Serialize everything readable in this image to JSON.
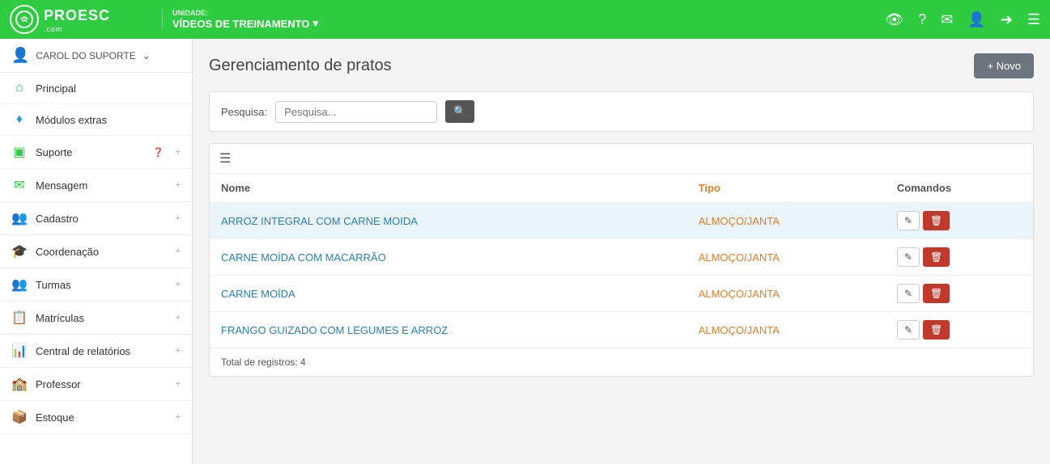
{
  "navbar": {
    "logo_text": "PROESC",
    "logo_sub": ".com",
    "unit_label": "UNIDADE:",
    "unit_name": "VÍDEOS DE TREINAMENTO",
    "icons": [
      "eye-icon",
      "question-icon",
      "mail-icon",
      "user-icon",
      "logout-icon",
      "menu-icon"
    ]
  },
  "sidebar": {
    "user_name": "CAROL DO SUPORTE",
    "items": [
      {
        "label": "Principal",
        "icon": "home",
        "color": "icon-home",
        "expand": false
      },
      {
        "label": "Módulos extras",
        "icon": "gem",
        "color": "icon-gem",
        "expand": false
      },
      {
        "label": "Suporte",
        "icon": "support",
        "color": "icon-support",
        "badge": "?",
        "expand": true
      },
      {
        "label": "Mensagem",
        "icon": "msg",
        "color": "icon-msg",
        "expand": true
      },
      {
        "label": "Cadastro",
        "icon": "cadastro",
        "color": "icon-cadastro",
        "expand": true
      },
      {
        "label": "Coordenação",
        "icon": "coord",
        "color": "icon-coord",
        "expand": true
      },
      {
        "label": "Turmas",
        "icon": "turmas",
        "color": "icon-turmas",
        "expand": true
      },
      {
        "label": "Matrículas",
        "icon": "matriculas",
        "color": "icon-matriculas",
        "expand": true
      },
      {
        "label": "Central de relatórios",
        "icon": "relatorios",
        "color": "icon-relatorios",
        "expand": true
      },
      {
        "label": "Professor",
        "icon": "professor",
        "color": "icon-professor",
        "expand": true
      },
      {
        "label": "Estoque",
        "icon": "estoque",
        "color": "icon-estoque",
        "expand": true
      }
    ]
  },
  "page": {
    "title": "Gerenciamento de pratos",
    "btn_novo": "+ Novo",
    "search_label": "Pesquisa:",
    "search_placeholder": "Pesquisa...",
    "table": {
      "col_nome": "Nome",
      "col_tipo": "Tipo",
      "col_comandos": "Comandos",
      "rows": [
        {
          "nome": "ARROZ INTEGRAL COM CARNE MOIDA",
          "tipo": "ALMOÇO/JANTA",
          "highlight": true
        },
        {
          "nome": "CARNE MOÍDA COM MACARRÃO",
          "tipo": "ALMOÇO/JANTA",
          "highlight": false
        },
        {
          "nome": "CARNE MOÍDA",
          "tipo": "ALMOÇO/JANTA",
          "highlight": false
        },
        {
          "nome": "FRANGO GUIZADO COM LEGUMES E ARROZ",
          "tipo": "ALMOÇO/JANTA",
          "highlight": false
        }
      ],
      "footer": "Total de registros: 4"
    }
  }
}
